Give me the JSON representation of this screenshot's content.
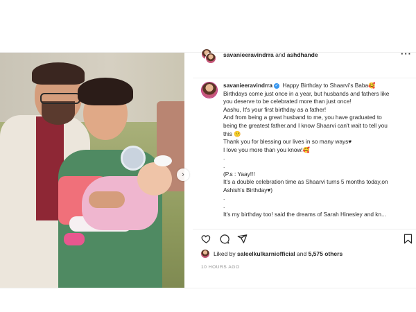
{
  "post": {
    "header": {
      "user1": "savanieeravindrra",
      "conj": " and ",
      "user2": "ashdhande",
      "more_icon": "more-horizontal-icon"
    },
    "caption": {
      "username": "savanieeravindrra",
      "verified_icon": "verified-badge-icon",
      "lines": [
        "Happy Birthday to Shaarvi's Baba🥰",
        "Birthdays come just once in a year, but husbands and fathers like",
        "you deserve to be celebrated more than just once!",
        "Aashu, It's your first birthday as a father!",
        "And from being a great husband to me, you have graduated to",
        "being the greatest father.and I know Shaarvi can't wait to tell you",
        "this 🙂",
        "Thank you for blessing our lives in so many ways♥",
        "I love you more than you know!🥰",
        ".",
        ".",
        "(P.s : Yaay!!!",
        "It's a double celebration time as Shaarvi turns 5 months today,on",
        "Ashish's Birthday♥)",
        ".",
        ".",
        "It's my birthday too! said the dreams of Sarah Hinesley and kn..."
      ]
    },
    "actions": {
      "like_icon": "heart-icon",
      "comment_icon": "comment-icon",
      "share_icon": "share-icon",
      "save_icon": "bookmark-icon"
    },
    "likes": {
      "prefix": "Liked by ",
      "user": "saleelkulkarniofficial",
      "middle": " and ",
      "count": "5,575 others"
    },
    "timestamp": "10 HOURS AGO"
  }
}
